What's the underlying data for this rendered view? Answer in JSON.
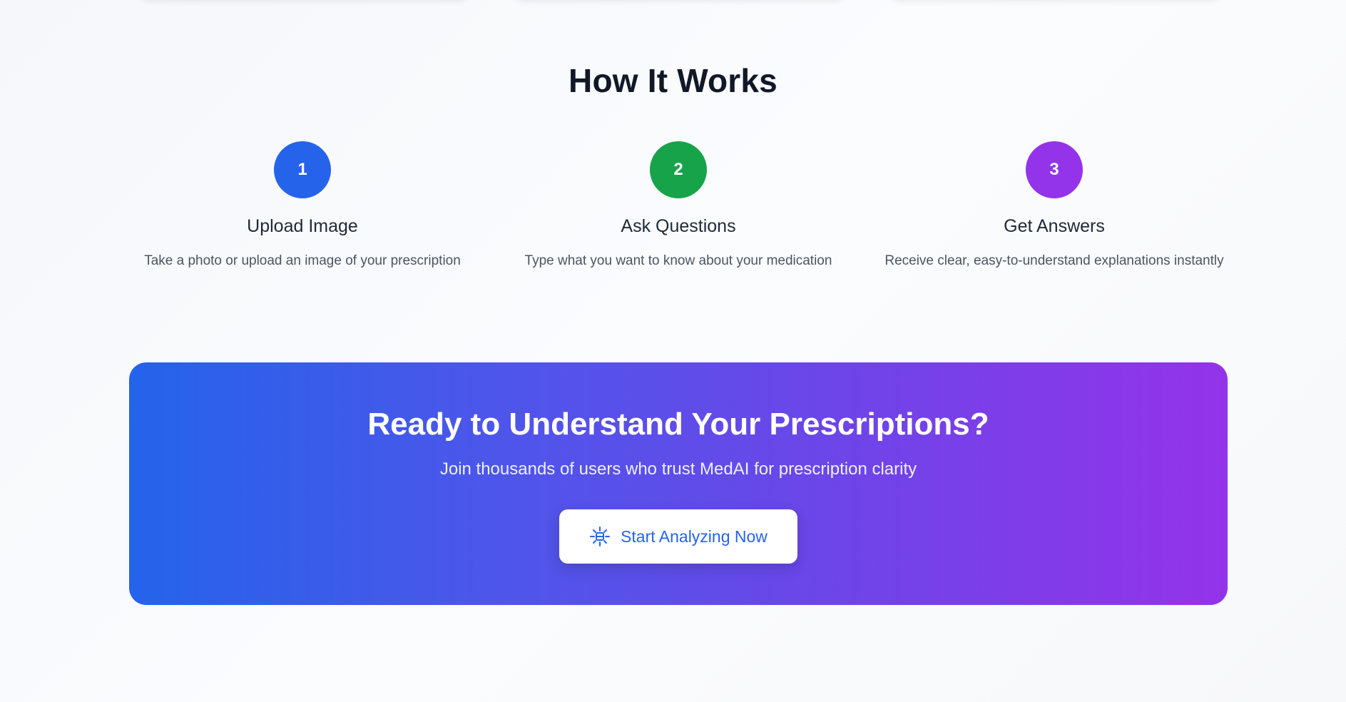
{
  "how_it_works": {
    "title": "How It Works",
    "steps": [
      {
        "number": "1",
        "title": "Upload Image",
        "description": "Take a photo or upload an image of your prescription",
        "color": "#2563eb"
      },
      {
        "number": "2",
        "title": "Ask Questions",
        "description": "Type what you want to know about your medication",
        "color": "#16a34a"
      },
      {
        "number": "3",
        "title": "Get Answers",
        "description": "Receive clear, easy-to-understand explanations instantly",
        "color": "#9333ea"
      }
    ]
  },
  "cta": {
    "title": "Ready to Understand Your Prescriptions?",
    "subtitle": "Join thousands of users who trust MedAI for prescription clarity",
    "button_label": "Start Analyzing Now",
    "button_icon": "sparkle-icon",
    "gradient_start": "#2563eb",
    "gradient_end": "#9333ea"
  }
}
